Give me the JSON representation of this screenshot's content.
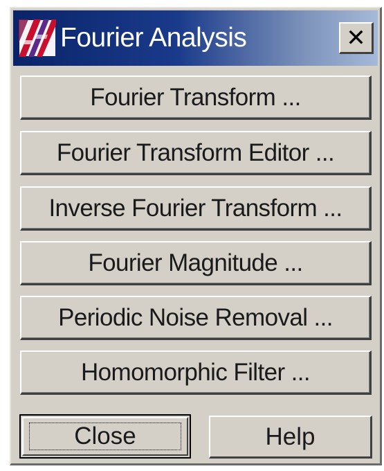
{
  "window": {
    "title": "Fourier Analysis",
    "close_glyph": "✕",
    "icon": "fourier-app-icon"
  },
  "menu": {
    "items": [
      {
        "label": "Fourier Transform ..."
      },
      {
        "label": "Fourier Transform Editor ..."
      },
      {
        "label": "Inverse Fourier Transform ..."
      },
      {
        "label": "Fourier Magnitude ..."
      },
      {
        "label": "Periodic Noise Removal ..."
      },
      {
        "label": "Homomorphic Filter ..."
      }
    ]
  },
  "footer": {
    "close_label": "Close",
    "help_label": "Help"
  },
  "colors": {
    "title_bar_start": "#0a246a",
    "title_bar_end": "#a6b9d8",
    "face": "#d4d0c8"
  }
}
